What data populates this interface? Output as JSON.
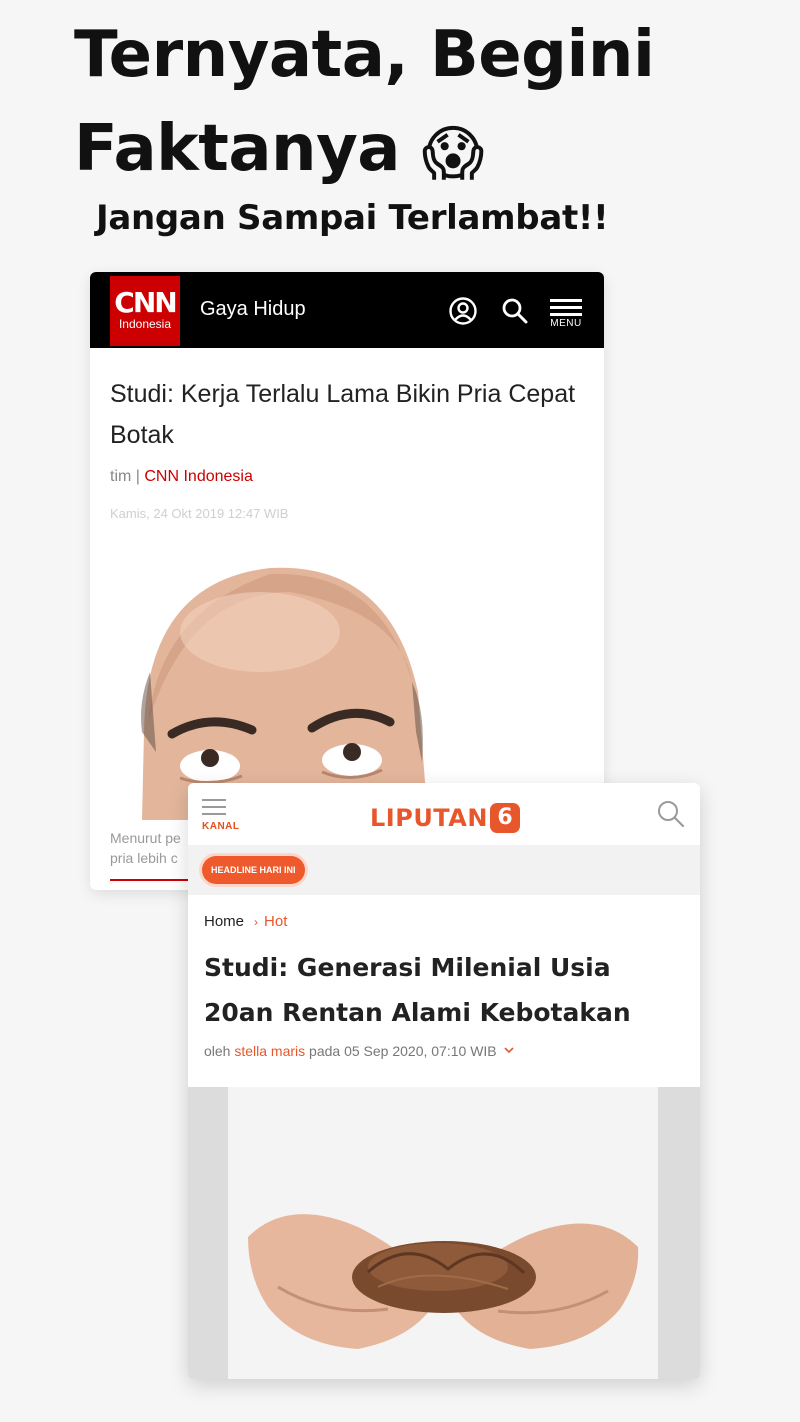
{
  "headline": {
    "text": "Ternyata, Begini Faktanya",
    "emoji": "😱",
    "subtitle": "Jangan Sampai Terlambat!!"
  },
  "cnn": {
    "logo_main": "CNN",
    "logo_sub": "Indonesia",
    "section": "Gaya Hidup",
    "menu_label": "MENU",
    "title": "Studi: Kerja Terlalu Lama Bikin Pria Cepat Botak",
    "byline_author": "tim | ",
    "byline_source": "CNN Indonesia",
    "date": "Kamis, 24 Okt 2019 12:47 WIB",
    "caption_line1": "Menurut pe",
    "caption_line2": "pria lebih c",
    "brand_color": "#cc0000"
  },
  "liputan": {
    "kanal_label": "KANAL",
    "logo_word": "LIPUTAN",
    "logo_number": "6",
    "badge": "HEADLINE HARI INI",
    "breadcrumb": {
      "home": "Home",
      "separator": "›",
      "current": "Hot"
    },
    "title": "Studi: Generasi Milenial Usia 20an Rentan Alami Kebotakan",
    "meta_prefix": "oleh ",
    "author": "stella maris",
    "meta_suffix": " pada 05 Sep 2020, 07:10 WIB",
    "brand_color": "#e8572b"
  }
}
